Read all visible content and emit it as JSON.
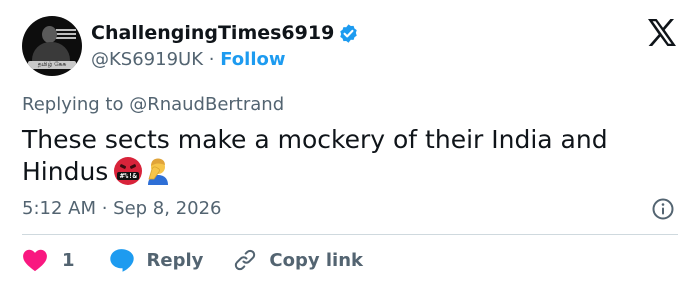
{
  "author": {
    "display_name": "ChallengingTimes6919",
    "handle": "@KS6919UK",
    "separator": "·",
    "follow_label": "Follow",
    "verified": true,
    "avatar_banner_text": "தமிழ் கேசு"
  },
  "platform_logo": "x-logo",
  "tweet": {
    "replying_to": "Replying to @RnaudBertrand",
    "text": "These sects make a mockery of their India and Hindus",
    "emojis": [
      "face-with-symbols-on-mouth",
      "man-facepalming"
    ],
    "timestamp": "5:12 AM · Sep 8, 2026"
  },
  "actions": {
    "like_count": "1",
    "reply_label": "Reply",
    "copy_link_label": "Copy link"
  },
  "colors": {
    "accent": "#1d9bf0",
    "like": "#f91880",
    "text": "#0f1419",
    "muted": "#536471",
    "divider": "#cfd9de"
  },
  "icons": [
    "verified-badge-icon",
    "x-logo-icon",
    "info-icon",
    "heart-icon",
    "reply-bubble-icon",
    "link-icon"
  ]
}
